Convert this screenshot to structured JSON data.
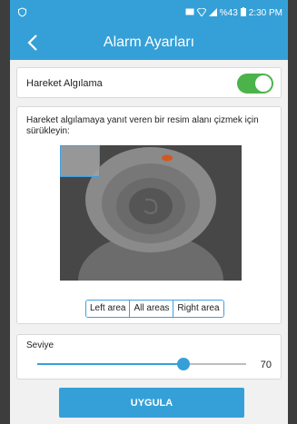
{
  "status_bar": {
    "signal": "%43",
    "time": "2:30 PM"
  },
  "app_bar": {
    "title": "Alarm Ayarları"
  },
  "motion_detection": {
    "label": "Hareket Algılama",
    "enabled": true
  },
  "detection_area": {
    "instruction": "Hareket algılamaya yanıt veren bir resim alanı çizmek için sürükleyin:",
    "buttons": [
      "Left area",
      "All areas",
      "Right area"
    ]
  },
  "level": {
    "label": "Seviye",
    "value": "70",
    "fraction": 0.7
  },
  "apply_button": "UYGULA",
  "colors": {
    "accent": "#35a0d8",
    "toggle_on": "#4cb34b"
  }
}
